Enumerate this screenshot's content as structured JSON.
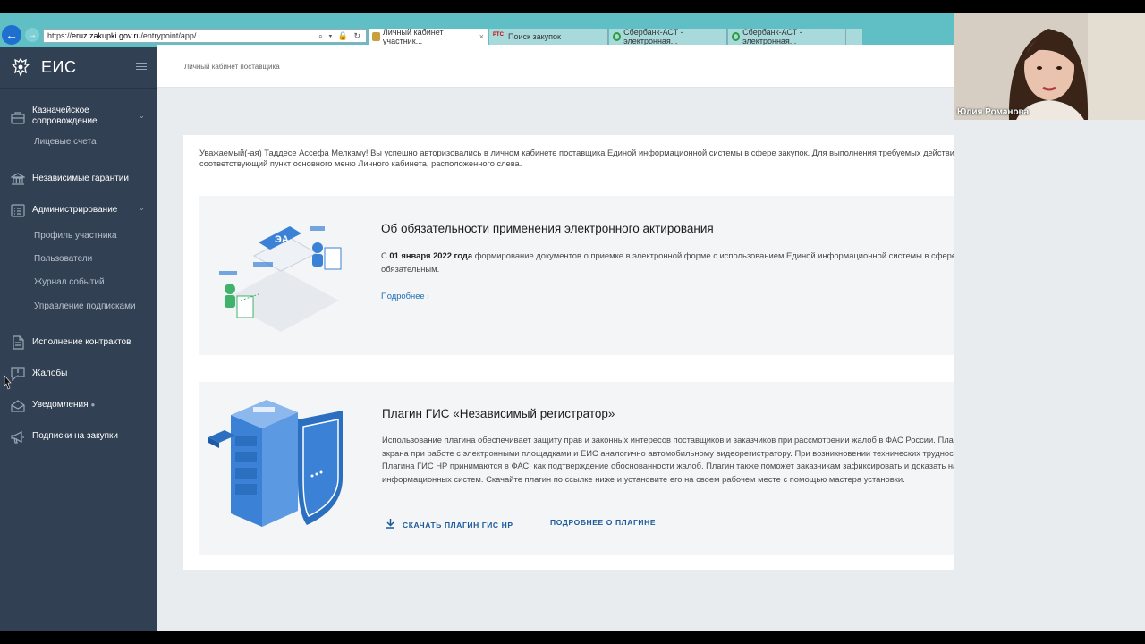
{
  "browser": {
    "url_prefix": "https://",
    "url_host": "eruz.zakupki.gov.ru",
    "url_path": "/entrypoint/app/",
    "addr_icons": "⌕ ▾ 🔒 ↻",
    "tabs": [
      {
        "label": "Личный кабинет участник...",
        "close": "×"
      },
      {
        "label": "Поиск закупок"
      },
      {
        "label": "Сбербанк-АСТ - электронная..."
      },
      {
        "label": "Сбербанк-АСТ - электронная..."
      }
    ],
    "fav_rts": "РТС"
  },
  "sidebar": {
    "logo": "ЕИС",
    "items": [
      {
        "label": "Казначейское сопровождение"
      },
      {
        "label": "Независимые гарантии"
      },
      {
        "label": "Администрирование"
      },
      {
        "label": "Исполнение контрактов"
      },
      {
        "label": "Жалобы"
      },
      {
        "label": "Уведомления"
      },
      {
        "label": "Подписки на закупки"
      }
    ],
    "sub_treasury": [
      "Лицевые счета"
    ],
    "sub_admin": [
      "Профиль участника",
      "Пользователи",
      "Журнал событий",
      "Управление подписками"
    ]
  },
  "header": {
    "breadcrumb": "Личный кабинет поставщика"
  },
  "welcome": "Уважаемый(-ая) Таддесе Ассефа Мелкаму! Вы успешно авторизовались в личном кабинете поставщика Единой информационной системы в сфере закупок. Для выполнения требуемых действий выберите соответствующий пункт основного меню Личного кабинета, расположенного слева.",
  "panel1": {
    "title": "Об обязательности применения электронного актирования",
    "text_before": "С ",
    "text_bold": "01 января 2022 года",
    "text_after": " формирование документов о приемке в электронной форме с использованием Единой информационной системы в сфере закупок для контрактов является обязательным.",
    "more": "Подробнее",
    "illus_label": "ЭА"
  },
  "panel2": {
    "title": "Плагин ГИС «Независимый регистратор»",
    "text": "Использование плагина обеспечивает защиту прав и законных интересов поставщиков и заказчиков при рассмотрении жалоб в ФАС России. Плагин позволяет снимать видео с экрана при работе с электронными площадками и ЕИС аналогично автомобильному видеорегистратору. При возникновении технических трудностей или ошибок видеозаписи Плагина ГИС НР принимаются в ФАС, как подтверждение обоснованности жалоб. Плагин также поможет заказчикам зафиксировать и доказать наличие перебоев в работе информационных систем. Скачайте плагин по ссылке ниже и установите его на своем рабочем месте с помощью мастера установки.",
    "download": "СКАЧАТЬ ПЛАГИН ГИС НР",
    "about": "ПОДРОБНЕЕ О ПЛАГИНЕ"
  },
  "webcam": {
    "name": "Юлия Романова"
  },
  "colors": {
    "sidebar": "#324054",
    "browser_bar": "#5fbfc4",
    "link": "#1b6fb5",
    "illus_blue": "#3b82d6"
  }
}
